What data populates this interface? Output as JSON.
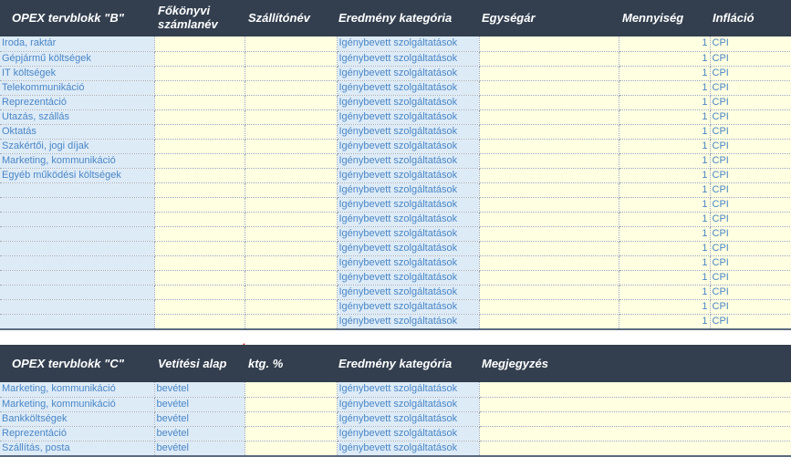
{
  "block_b": {
    "headers": [
      "OPEX tervblokk \"B\"",
      "Főkönyvi számlanév",
      "Szállítónév",
      "Eredmény kategória",
      "Egységár",
      "Mennyiség",
      "Infláció"
    ],
    "rows": [
      {
        "name": "Iroda, raktár",
        "category": "Igénybevett szolgáltatások",
        "qty": "1",
        "inflation": "CPI"
      },
      {
        "name": "Gépjármű költségek",
        "category": "Igénybevett szolgáltatások",
        "qty": "1",
        "inflation": "CPI"
      },
      {
        "name": "IT költségek",
        "category": "Igénybevett szolgáltatások",
        "qty": "1",
        "inflation": "CPI"
      },
      {
        "name": "Telekommunikáció",
        "category": "Igénybevett szolgáltatások",
        "qty": "1",
        "inflation": "CPI"
      },
      {
        "name": "Reprezentáció",
        "category": "Igénybevett szolgáltatások",
        "qty": "1",
        "inflation": "CPI"
      },
      {
        "name": "Utazás, szállás",
        "category": "Igénybevett szolgáltatások",
        "qty": "1",
        "inflation": "CPI"
      },
      {
        "name": "Oktatás",
        "category": "Igénybevett szolgáltatások",
        "qty": "1",
        "inflation": "CPI"
      },
      {
        "name": "Szakértői, jogi díjak",
        "category": "Igénybevett szolgáltatások",
        "qty": "1",
        "inflation": "CPI"
      },
      {
        "name": "Marketing, kommunikáció",
        "category": "Igénybevett szolgáltatások",
        "qty": "1",
        "inflation": "CPI"
      },
      {
        "name": "Egyéb működési költségek",
        "category": "Igénybevett szolgáltatások",
        "qty": "1",
        "inflation": "CPI"
      },
      {
        "name": "",
        "category": "Igénybevett szolgáltatások",
        "qty": "1",
        "inflation": "CPI"
      },
      {
        "name": "",
        "category": "Igénybevett szolgáltatások",
        "qty": "1",
        "inflation": "CPI"
      },
      {
        "name": "",
        "category": "Igénybevett szolgáltatások",
        "qty": "1",
        "inflation": "CPI"
      },
      {
        "name": "",
        "category": "Igénybevett szolgáltatások",
        "qty": "1",
        "inflation": "CPI"
      },
      {
        "name": "",
        "category": "Igénybevett szolgáltatások",
        "qty": "1",
        "inflation": "CPI"
      },
      {
        "name": "",
        "category": "Igénybevett szolgáltatások",
        "qty": "1",
        "inflation": "CPI"
      },
      {
        "name": "",
        "category": "Igénybevett szolgáltatások",
        "qty": "1",
        "inflation": "CPI"
      },
      {
        "name": "",
        "category": "Igénybevett szolgáltatások",
        "qty": "1",
        "inflation": "CPI"
      },
      {
        "name": "",
        "category": "Igénybevett szolgáltatások",
        "qty": "1",
        "inflation": "CPI"
      },
      {
        "name": "",
        "category": "Igénybevett szolgáltatások",
        "qty": "1",
        "inflation": "CPI"
      }
    ]
  },
  "block_c": {
    "headers": [
      "OPEX tervblokk \"C\"",
      "Vetítési alap",
      "ktg. %",
      "Eredmény kategória",
      "Megjegyzés"
    ],
    "rows": [
      {
        "name": "Marketing, kommunikáció",
        "base": "bevétel",
        "category": "Igénybevett szolgáltatások"
      },
      {
        "name": "Marketing, kommunikáció",
        "base": "bevétel",
        "category": "Igénybevett szolgáltatások"
      },
      {
        "name": "Bankköltségek",
        "base": "bevétel",
        "category": "Igénybevett szolgáltatások"
      },
      {
        "name": "Reprezentáció",
        "base": "bevétel",
        "category": "Igénybevett szolgáltatások"
      },
      {
        "name": "Szállítás, posta",
        "base": "bevétel",
        "category": "Igénybevett szolgáltatások"
      }
    ]
  }
}
